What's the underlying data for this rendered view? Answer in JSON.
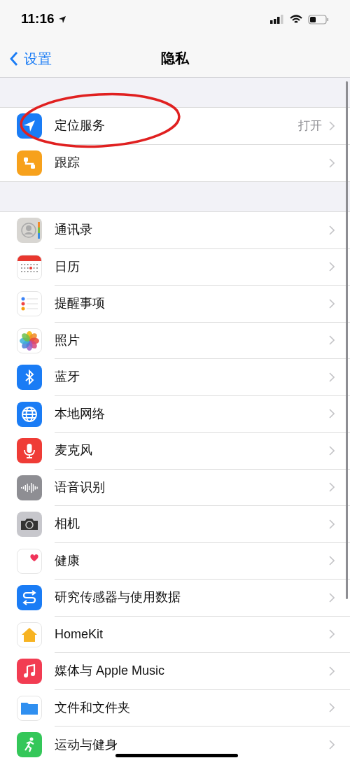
{
  "status_bar": {
    "time": "11:16"
  },
  "nav": {
    "back": "设置",
    "title": "隐私"
  },
  "sections": [
    {
      "rows": [
        {
          "label": "定位服务",
          "value": "打开",
          "highlighted": true
        },
        {
          "label": "跟踪",
          "highlighted": false
        }
      ]
    },
    {
      "rows": [
        {
          "label": "通讯录",
          "highlighted": false
        },
        {
          "label": "日历",
          "highlighted": false
        },
        {
          "label": "提醒事项",
          "highlighted": false
        },
        {
          "label": "照片",
          "highlighted": false
        },
        {
          "label": "蓝牙",
          "highlighted": false
        },
        {
          "label": "本地网络",
          "highlighted": false
        },
        {
          "label": "麦克风",
          "highlighted": false
        },
        {
          "label": "语音识别",
          "highlighted": false
        },
        {
          "label": "相机",
          "highlighted": false
        },
        {
          "label": "健康",
          "highlighted": false
        },
        {
          "label": "研究传感器与使用数据",
          "highlighted": false
        },
        {
          "label": "HomeKit",
          "highlighted": false
        },
        {
          "label": "媒体与 Apple Music",
          "highlighted": false
        },
        {
          "label": "文件和文件夹",
          "highlighted": false
        },
        {
          "label": "运动与健身",
          "highlighted": false
        }
      ]
    }
  ]
}
